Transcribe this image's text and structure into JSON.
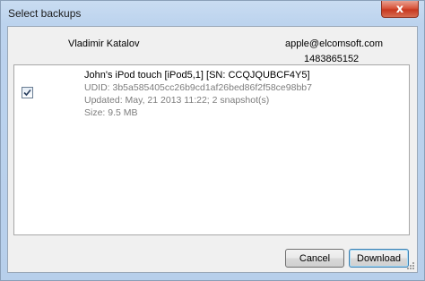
{
  "window": {
    "title": "Select backups",
    "close_symbol": "x"
  },
  "owner": {
    "name": "Vladimir Katalov",
    "email": "apple@elcomsoft.com",
    "id": "1483865152"
  },
  "backups": [
    {
      "checked": true,
      "device": "John's iPod touch [iPod5,1] [SN: CCQJQUBCF4Y5]",
      "udid": "UDID: 3b5a585405cc26b9cd1af26bed86f2f58ce98bb7",
      "updated": "Updated: May, 21 2013 11:22; 2 snapshot(s)",
      "size": "Size: 9.5 MB"
    }
  ],
  "buttons": {
    "cancel": "Cancel",
    "download": "Download"
  },
  "icons": {
    "close": "close-icon",
    "check": "checkmark-icon",
    "grip": "resize-grip-icon"
  },
  "colors": {
    "close_button": "#d9573d",
    "secondary_text": "#7d7d7d",
    "default_button_border": "#3c7fb1"
  }
}
